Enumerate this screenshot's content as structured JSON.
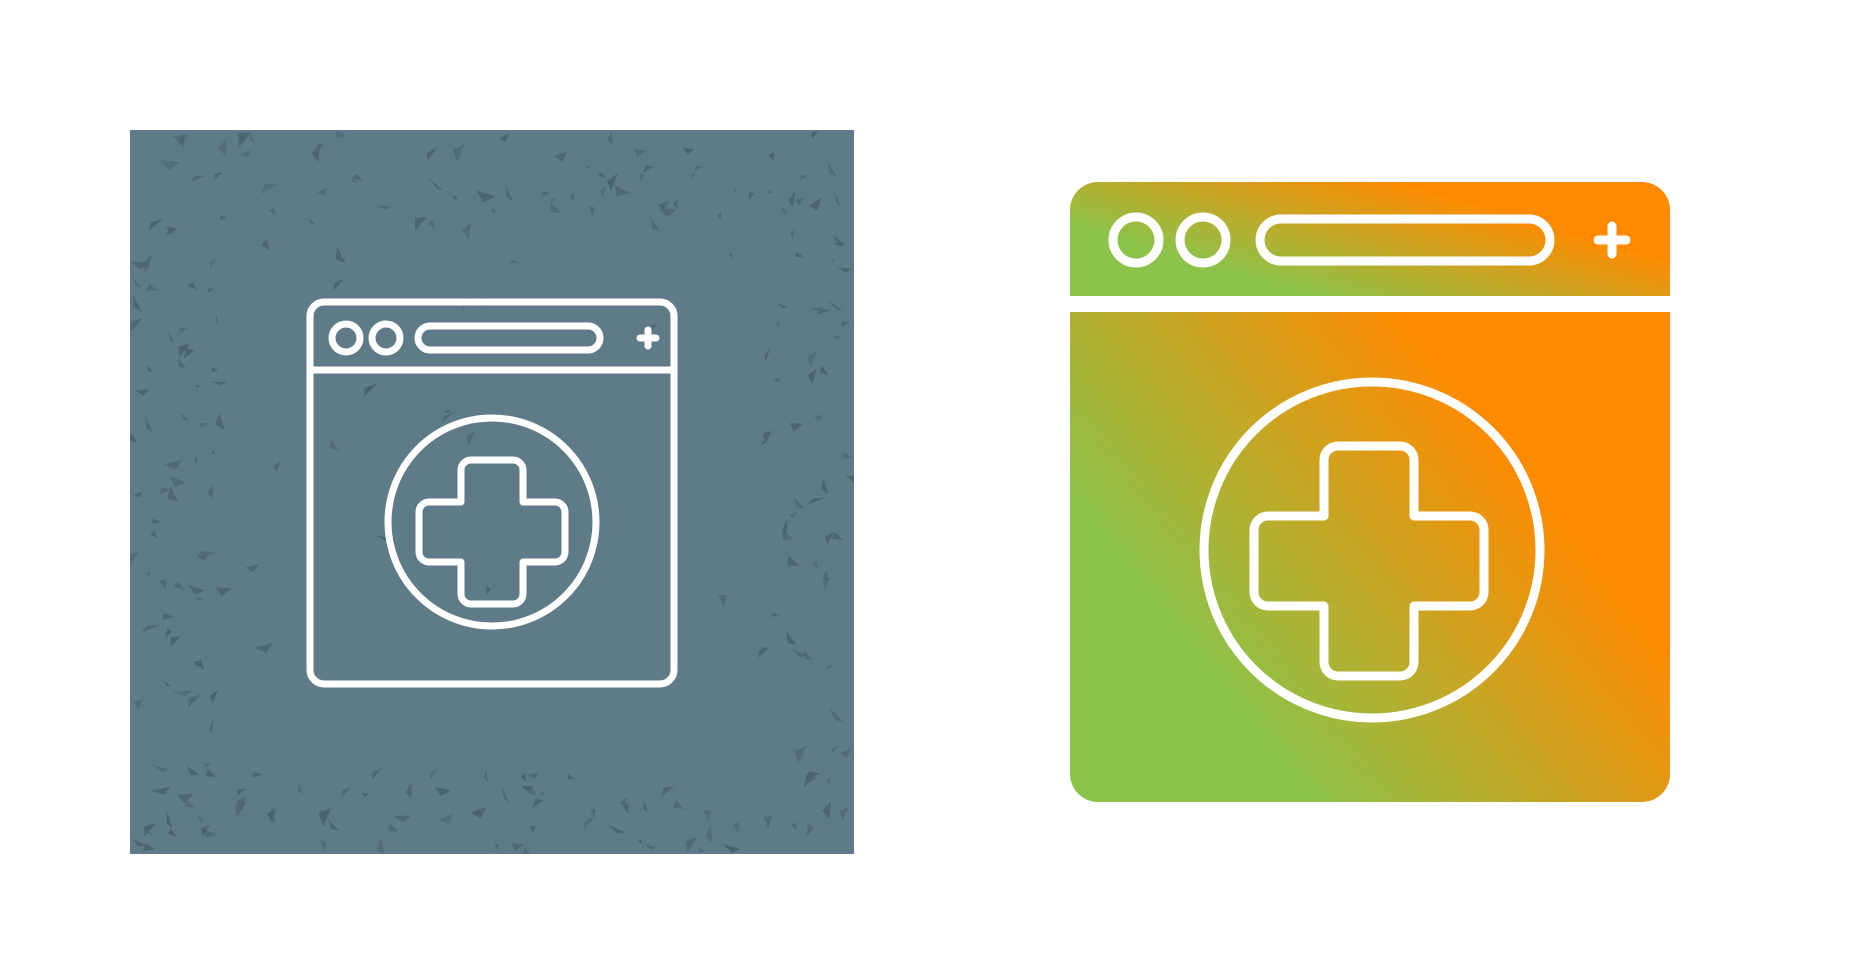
{
  "icons": [
    {
      "name": "medical-website-outline-icon",
      "style": "outline-on-grunge-tile",
      "colors": {
        "tile_background": "#5f7b88",
        "grunge_marks": "#4a6370",
        "stroke": "#ffffff"
      }
    },
    {
      "name": "medical-website-gradient-icon",
      "style": "gradient-filled",
      "colors": {
        "gradient_start": "#8bc34a",
        "gradient_end": "#ff8a00",
        "stroke": "#ffffff"
      }
    }
  ]
}
